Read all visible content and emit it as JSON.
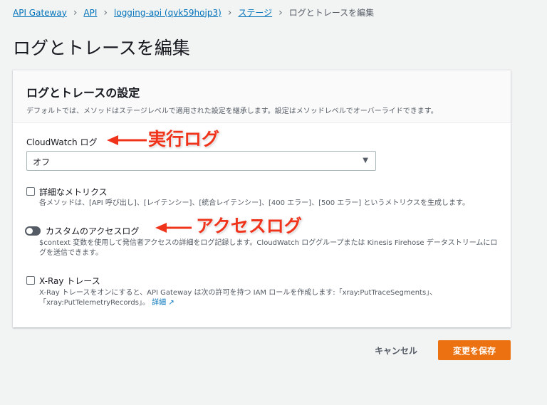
{
  "breadcrumb": [
    "API Gateway",
    "API",
    "logging-api (qvk59hojp3)",
    "ステージ",
    "ログとトレースを編集"
  ],
  "page_title": "ログとトレースを編集",
  "card": {
    "title": "ログとトレースの設定",
    "description": "デフォルトでは、メソッドはステージレベルで適用された設定を継承します。設定はメソッドレベルでオーバーライドできます。"
  },
  "cloudwatch": {
    "label": "CloudWatch ログ",
    "value": "オフ"
  },
  "metrics": {
    "label": "詳細なメトリクス",
    "checked": false,
    "description": "各メソッドは、[API 呼び出し]、[レイテンシー]、[統合レイテンシー]、[400 エラー]、[500 エラー] というメトリクスを生成します。"
  },
  "access_log": {
    "label": "カスタムのアクセスログ",
    "enabled": false,
    "description": "$context 変数を使用して発信者アクセスの詳細をログ記録します。CloudWatch ロググループまたは Kinesis Firehose データストリームにログを送信できます。"
  },
  "xray": {
    "label": "X-Ray トレース",
    "checked": false,
    "description": "X-Ray トレースをオンにすると、API Gateway は次の許可を持つ IAM ロールを作成します:「xray:PutTraceSegments」、「xray:PutTelemetryRecords」。",
    "link": "詳細"
  },
  "buttons": {
    "cancel": "キャンセル",
    "save": "変更を保存"
  },
  "annotations": {
    "exec_log": "実行ログ",
    "access_log": "アクセスログ"
  }
}
